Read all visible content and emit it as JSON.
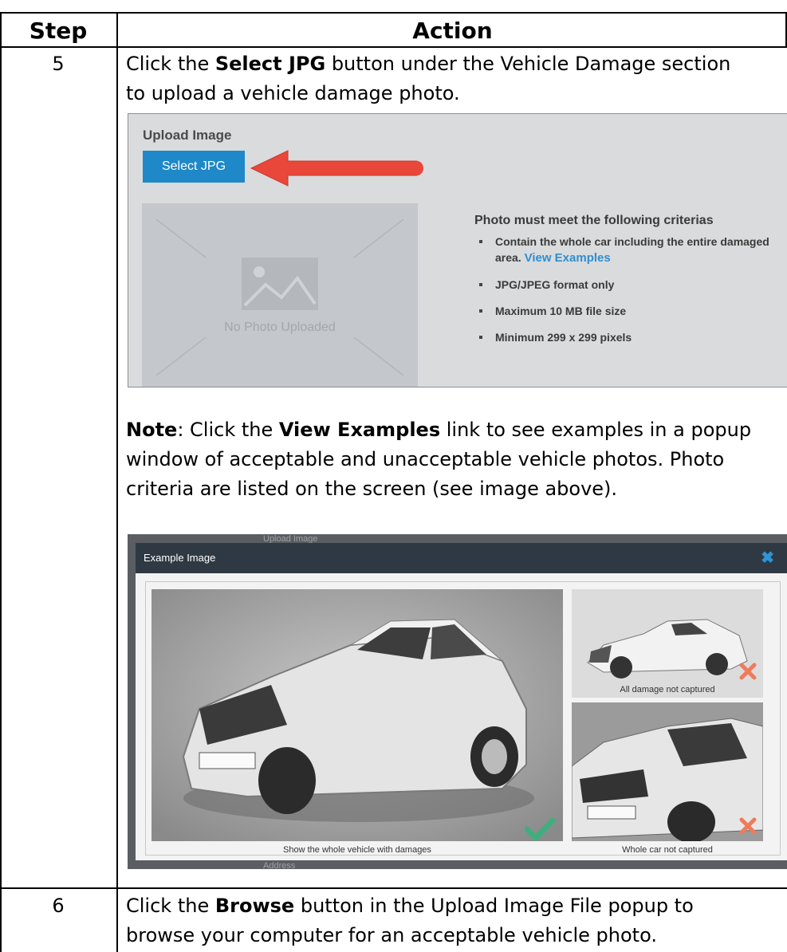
{
  "table": {
    "col_step": "Step",
    "col_action": "Action",
    "rows": [
      {
        "step": "5",
        "intro": {
          "before": "Click the ",
          "bold": "Select JPG",
          "after_line1": " button under the Vehicle Damage section",
          "line2": "to upload a vehicle damage photo."
        },
        "note": {
          "label": "Note",
          "text1": ": Click the ",
          "bold": "View Examples",
          "text2": " link to see examples in a popup",
          "line2": "window of acceptable and unacceptable vehicle photos. Photo",
          "line3": "criteria are listed on the screen (see image above)."
        }
      },
      {
        "step": "6",
        "line1_before": "Click the ",
        "line1_bold": "Browse",
        "line1_after": " button in the Upload Image File popup to",
        "line2": "browse your computer for an acceptable vehicle photo."
      }
    ]
  },
  "upload": {
    "title": "Upload Image",
    "button": "Select JPG",
    "no_photo": "No Photo Uploaded",
    "criteria_heading": "Photo must meet the following criterias",
    "criteria": [
      {
        "text": "Contain the whole car including the entire damaged area.",
        "link": "View Examples"
      },
      {
        "text": "JPG/JPEG format only"
      },
      {
        "text": "Maximum 10 MB file size"
      },
      {
        "text": "Minimum 299 x 299 pixels"
      }
    ],
    "colors": {
      "button": "#1e88c9",
      "arrow": "#e8473a",
      "panel": "#d9dbdd"
    }
  },
  "example": {
    "title": "Example Image",
    "bg_top": "Upload Image",
    "bg_bottom": "Address",
    "main_caption": "Show the whole vehicle with damages",
    "thumb1_caption": "All damage not captured",
    "thumb2_caption": "Whole car not captured",
    "icons": {
      "ok": "check-icon",
      "bad": "x-icon",
      "close": "close-icon"
    },
    "colors": {
      "ok": "#3fae7f",
      "bad": "#ef7b5b",
      "close": "#2f95d6"
    }
  }
}
